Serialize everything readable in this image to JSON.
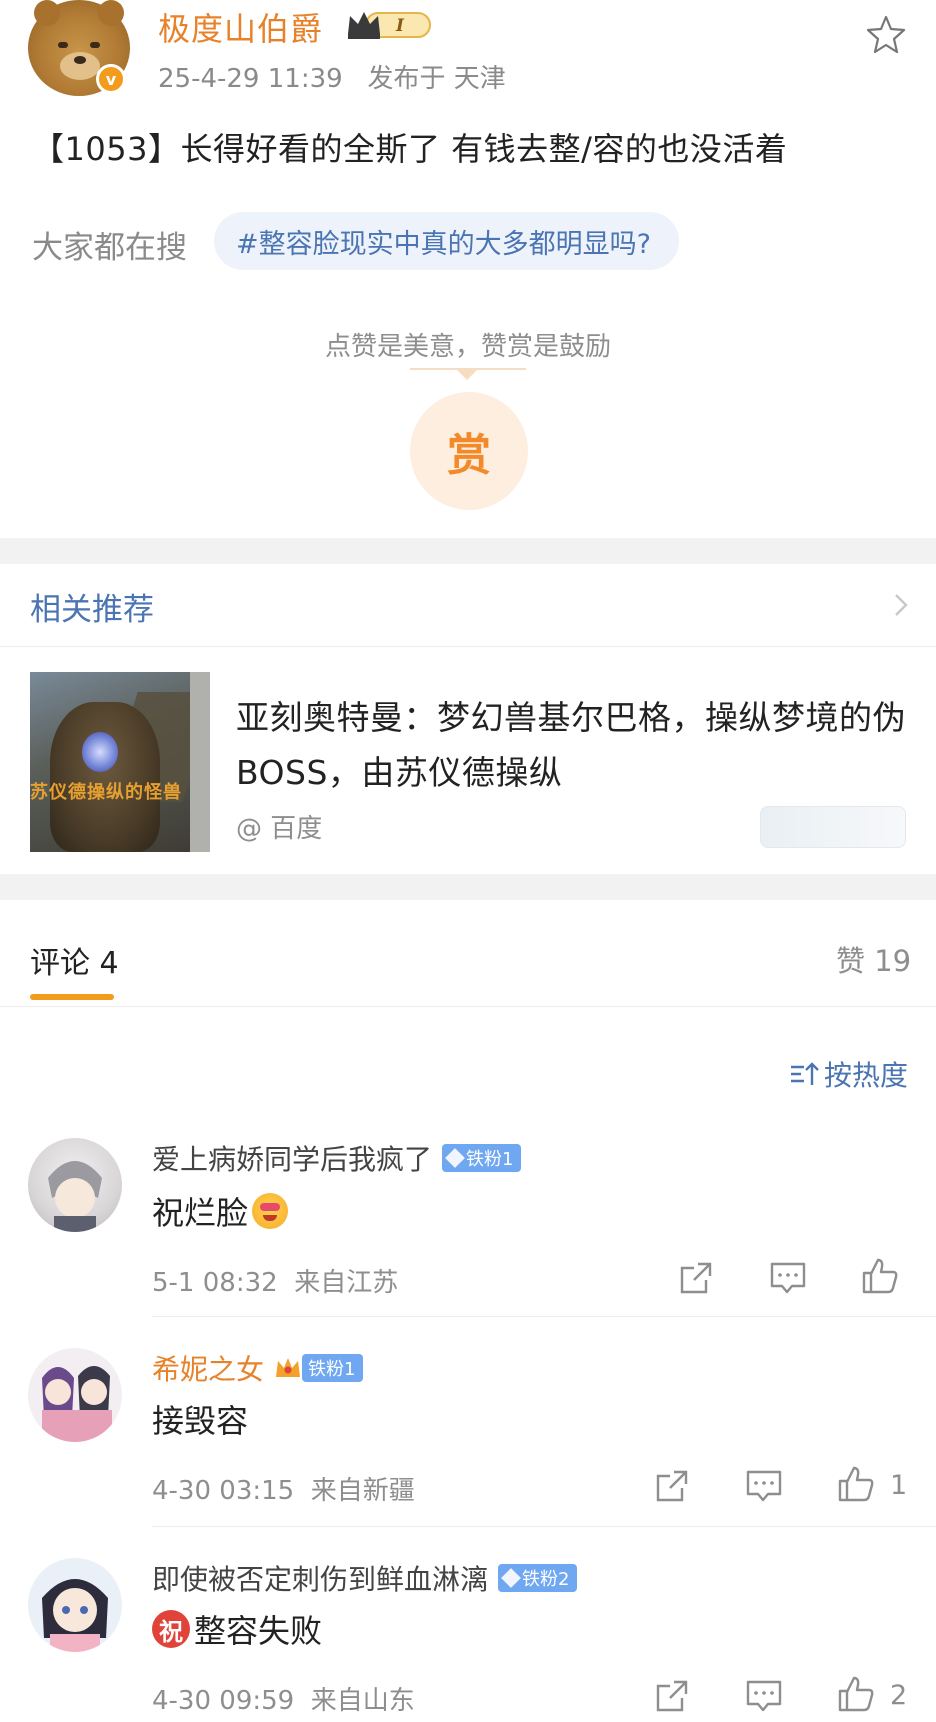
{
  "post": {
    "author": "极度山伯爵",
    "vip_level": "I",
    "verify_mark": "v",
    "timestamp": "25-4-29 11:39",
    "location": "发布于 天津",
    "text": "【1053】长得好看的全斯了 有钱去整/容的也没活着",
    "search_label": "大家都在搜",
    "search_topic": "#整容脸现实中真的大多都明显吗?",
    "reward_hint": "点赞是美意，赞赏是鼓励",
    "reward_button": "赏"
  },
  "related": {
    "title": "相关推荐",
    "headline": "亚刻奥特曼：梦幻兽基尔巴格，操纵梦境的伪BOSS，由苏仪德操纵",
    "source": "@ 百度",
    "thumb_caption": "苏仪德操纵的怪兽"
  },
  "comments_header": {
    "tab_label": "评论 4",
    "likes_label": "赞 19",
    "sort_label": "按热度"
  },
  "comments": [
    {
      "name": "爱上病娇同学后我疯了",
      "badge": "铁粉1",
      "text": "祝烂脸",
      "time": "5-1 08:32",
      "location": "来自江苏",
      "likes": ""
    },
    {
      "name": "希妮之女",
      "badge": "铁粉1",
      "text": "接毁容",
      "time": "4-30 03:15",
      "location": "来自新疆",
      "likes": "1"
    },
    {
      "name": "即使被否定刺伤到鲜血淋漓",
      "badge": "铁粉2",
      "prefix_badge": "祝",
      "text": "整容失败",
      "time": "4-30 09:59",
      "location": "来自山东",
      "likes": "2"
    }
  ],
  "colors": {
    "accent_orange": "#e8822a",
    "link_blue": "#4b74b3",
    "fan_badge_blue": "#6fa7f0",
    "tab_underline": "#f39b1a"
  }
}
